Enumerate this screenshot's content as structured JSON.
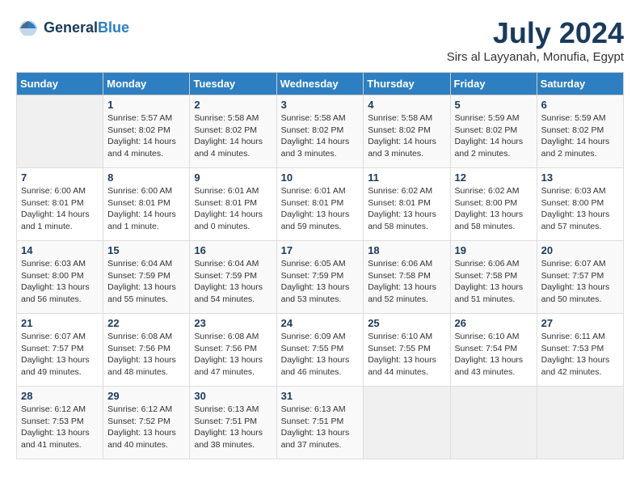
{
  "logo": {
    "line1": "General",
    "line2": "Blue"
  },
  "title": "July 2024",
  "subtitle": "Sirs al Layyanah, Monufia, Egypt",
  "days_of_week": [
    "Sunday",
    "Monday",
    "Tuesday",
    "Wednesday",
    "Thursday",
    "Friday",
    "Saturday"
  ],
  "weeks": [
    [
      {
        "day": "",
        "info": ""
      },
      {
        "day": "1",
        "info": "Sunrise: 5:57 AM\nSunset: 8:02 PM\nDaylight: 14 hours\nand 4 minutes."
      },
      {
        "day": "2",
        "info": "Sunrise: 5:58 AM\nSunset: 8:02 PM\nDaylight: 14 hours\nand 4 minutes."
      },
      {
        "day": "3",
        "info": "Sunrise: 5:58 AM\nSunset: 8:02 PM\nDaylight: 14 hours\nand 3 minutes."
      },
      {
        "day": "4",
        "info": "Sunrise: 5:58 AM\nSunset: 8:02 PM\nDaylight: 14 hours\nand 3 minutes."
      },
      {
        "day": "5",
        "info": "Sunrise: 5:59 AM\nSunset: 8:02 PM\nDaylight: 14 hours\nand 2 minutes."
      },
      {
        "day": "6",
        "info": "Sunrise: 5:59 AM\nSunset: 8:02 PM\nDaylight: 14 hours\nand 2 minutes."
      }
    ],
    [
      {
        "day": "7",
        "info": "Sunrise: 6:00 AM\nSunset: 8:01 PM\nDaylight: 14 hours\nand 1 minute."
      },
      {
        "day": "8",
        "info": "Sunrise: 6:00 AM\nSunset: 8:01 PM\nDaylight: 14 hours\nand 1 minute."
      },
      {
        "day": "9",
        "info": "Sunrise: 6:01 AM\nSunset: 8:01 PM\nDaylight: 14 hours\nand 0 minutes."
      },
      {
        "day": "10",
        "info": "Sunrise: 6:01 AM\nSunset: 8:01 PM\nDaylight: 13 hours\nand 59 minutes."
      },
      {
        "day": "11",
        "info": "Sunrise: 6:02 AM\nSunset: 8:01 PM\nDaylight: 13 hours\nand 58 minutes."
      },
      {
        "day": "12",
        "info": "Sunrise: 6:02 AM\nSunset: 8:00 PM\nDaylight: 13 hours\nand 58 minutes."
      },
      {
        "day": "13",
        "info": "Sunrise: 6:03 AM\nSunset: 8:00 PM\nDaylight: 13 hours\nand 57 minutes."
      }
    ],
    [
      {
        "day": "14",
        "info": "Sunrise: 6:03 AM\nSunset: 8:00 PM\nDaylight: 13 hours\nand 56 minutes."
      },
      {
        "day": "15",
        "info": "Sunrise: 6:04 AM\nSunset: 7:59 PM\nDaylight: 13 hours\nand 55 minutes."
      },
      {
        "day": "16",
        "info": "Sunrise: 6:04 AM\nSunset: 7:59 PM\nDaylight: 13 hours\nand 54 minutes."
      },
      {
        "day": "17",
        "info": "Sunrise: 6:05 AM\nSunset: 7:59 PM\nDaylight: 13 hours\nand 53 minutes."
      },
      {
        "day": "18",
        "info": "Sunrise: 6:06 AM\nSunset: 7:58 PM\nDaylight: 13 hours\nand 52 minutes."
      },
      {
        "day": "19",
        "info": "Sunrise: 6:06 AM\nSunset: 7:58 PM\nDaylight: 13 hours\nand 51 minutes."
      },
      {
        "day": "20",
        "info": "Sunrise: 6:07 AM\nSunset: 7:57 PM\nDaylight: 13 hours\nand 50 minutes."
      }
    ],
    [
      {
        "day": "21",
        "info": "Sunrise: 6:07 AM\nSunset: 7:57 PM\nDaylight: 13 hours\nand 49 minutes."
      },
      {
        "day": "22",
        "info": "Sunrise: 6:08 AM\nSunset: 7:56 PM\nDaylight: 13 hours\nand 48 minutes."
      },
      {
        "day": "23",
        "info": "Sunrise: 6:08 AM\nSunset: 7:56 PM\nDaylight: 13 hours\nand 47 minutes."
      },
      {
        "day": "24",
        "info": "Sunrise: 6:09 AM\nSunset: 7:55 PM\nDaylight: 13 hours\nand 46 minutes."
      },
      {
        "day": "25",
        "info": "Sunrise: 6:10 AM\nSunset: 7:55 PM\nDaylight: 13 hours\nand 44 minutes."
      },
      {
        "day": "26",
        "info": "Sunrise: 6:10 AM\nSunset: 7:54 PM\nDaylight: 13 hours\nand 43 minutes."
      },
      {
        "day": "27",
        "info": "Sunrise: 6:11 AM\nSunset: 7:53 PM\nDaylight: 13 hours\nand 42 minutes."
      }
    ],
    [
      {
        "day": "28",
        "info": "Sunrise: 6:12 AM\nSunset: 7:53 PM\nDaylight: 13 hours\nand 41 minutes."
      },
      {
        "day": "29",
        "info": "Sunrise: 6:12 AM\nSunset: 7:52 PM\nDaylight: 13 hours\nand 40 minutes."
      },
      {
        "day": "30",
        "info": "Sunrise: 6:13 AM\nSunset: 7:51 PM\nDaylight: 13 hours\nand 38 minutes."
      },
      {
        "day": "31",
        "info": "Sunrise: 6:13 AM\nSunset: 7:51 PM\nDaylight: 13 hours\nand 37 minutes."
      },
      {
        "day": "",
        "info": ""
      },
      {
        "day": "",
        "info": ""
      },
      {
        "day": "",
        "info": ""
      }
    ]
  ]
}
